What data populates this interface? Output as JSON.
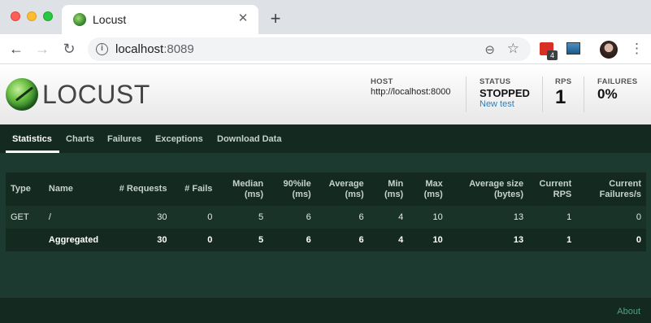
{
  "browser": {
    "tab_title": "Locust",
    "tab_close": "✕",
    "new_tab": "+",
    "url_host": "localhost",
    "url_port": ":8089",
    "extension_badge": "4"
  },
  "header": {
    "logo_text": "LOCUST",
    "host_label": "HOST",
    "host_value": "http://localhost:8000",
    "status_label": "STATUS",
    "status_value": "STOPPED",
    "new_test_label": "New test",
    "rps_label": "RPS",
    "rps_value": "1",
    "failures_label": "FAILURES",
    "failures_value": "0%"
  },
  "nav": {
    "tabs": [
      {
        "label": "Statistics",
        "active": true
      },
      {
        "label": "Charts"
      },
      {
        "label": "Failures"
      },
      {
        "label": "Exceptions"
      },
      {
        "label": "Download Data"
      }
    ]
  },
  "table": {
    "headers": {
      "type": "Type",
      "name": "Name",
      "requests": "# Requests",
      "fails": "# Fails",
      "median_1": "Median",
      "median_2": "(ms)",
      "p90_1": "90%ile",
      "p90_2": "(ms)",
      "avg_1": "Average",
      "avg_2": "(ms)",
      "min_1": "Min",
      "min_2": "(ms)",
      "max_1": "Max",
      "max_2": "(ms)",
      "size_1": "Average size",
      "size_2": "(bytes)",
      "rps_1": "Current",
      "rps_2": "RPS",
      "fpers_1": "Current",
      "fpers_2": "Failures/s"
    },
    "rows": [
      {
        "type": "GET",
        "name": "/",
        "requests": "30",
        "fails": "0",
        "median": "5",
        "p90": "6",
        "avg": "6",
        "min": "4",
        "max": "10",
        "size": "13",
        "rps": "1",
        "fpers": "0"
      }
    ],
    "aggregated": {
      "type": "",
      "name": "Aggregated",
      "requests": "30",
      "fails": "0",
      "median": "5",
      "p90": "6",
      "avg": "6",
      "min": "4",
      "max": "10",
      "size": "13",
      "rps": "1",
      "fpers": "0"
    }
  },
  "footer": {
    "about": "About"
  },
  "colors": {
    "page_bg": "#1d3a30",
    "nav_bg": "#14291f",
    "link": "#2f7fb8",
    "footer_link": "#4aa58a"
  }
}
